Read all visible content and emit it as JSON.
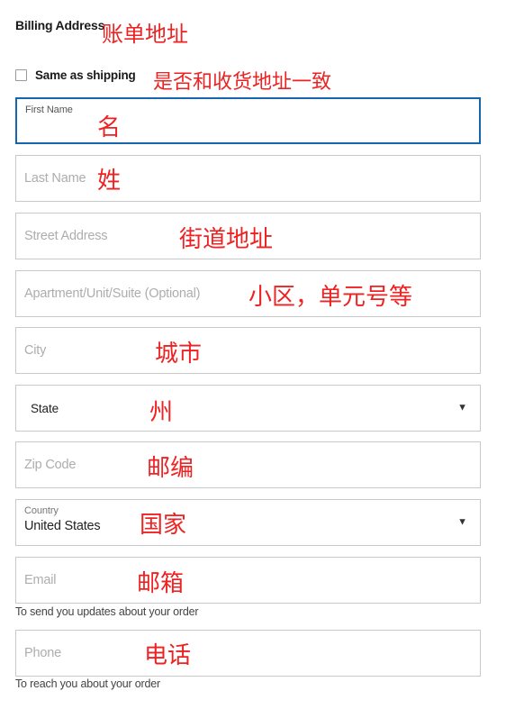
{
  "section": {
    "title": "Billing Address",
    "title_annotation": "账单地址"
  },
  "same_as_shipping": {
    "label": "Same as shipping",
    "annotation": "是否和收货地址一致",
    "checked": false,
    "icon": "checkbox-unchecked-icon"
  },
  "colors": {
    "focus_border": "#1565b0",
    "field_border": "#c9c9c9",
    "placeholder": "#adadad",
    "annotation_red": "#ee2222",
    "text": "#222222"
  },
  "fields": [
    {
      "name": "first-name",
      "label": "First Name",
      "value": "",
      "placeholder": "First Name",
      "annotation": "名",
      "focused": true,
      "floating_label": true,
      "type": "text"
    },
    {
      "name": "last-name",
      "label": "Last Name",
      "value": "",
      "placeholder": "Last Name",
      "annotation": "姓",
      "focused": false,
      "floating_label": false,
      "type": "text"
    },
    {
      "name": "street-address",
      "label": "Street Address",
      "value": "",
      "placeholder": "Street Address",
      "annotation": "街道地址",
      "focused": false,
      "floating_label": false,
      "type": "text"
    },
    {
      "name": "apartment",
      "label": "Apartment/Unit/Suite (Optional)",
      "value": "",
      "placeholder": "Apartment/Unit/Suite (Optional)",
      "annotation": "小区，单元号等",
      "focused": false,
      "floating_label": false,
      "type": "text"
    },
    {
      "name": "city",
      "label": "City",
      "value": "",
      "placeholder": "City",
      "annotation": "城市",
      "focused": false,
      "floating_label": false,
      "type": "text"
    },
    {
      "name": "state",
      "label": "State",
      "value": "State",
      "placeholder": "State",
      "annotation": "州",
      "focused": false,
      "floating_label": false,
      "type": "select",
      "caret": "▼"
    },
    {
      "name": "zip-code",
      "label": "Zip Code",
      "value": "",
      "placeholder": "Zip Code",
      "annotation": "邮编",
      "focused": false,
      "floating_label": false,
      "type": "text"
    },
    {
      "name": "country",
      "label": "Country",
      "value": "United States",
      "placeholder": "Country",
      "annotation": "国家",
      "focused": false,
      "floating_label": true,
      "type": "select",
      "caret": "▼"
    },
    {
      "name": "email",
      "label": "Email",
      "value": "",
      "placeholder": "Email",
      "annotation": "邮箱",
      "focused": false,
      "floating_label": false,
      "type": "text",
      "helper": "To send you updates about your order"
    },
    {
      "name": "phone",
      "label": "Phone",
      "value": "",
      "placeholder": "Phone",
      "annotation": "电话",
      "focused": false,
      "floating_label": false,
      "type": "text",
      "helper": "To reach you about your order"
    }
  ]
}
